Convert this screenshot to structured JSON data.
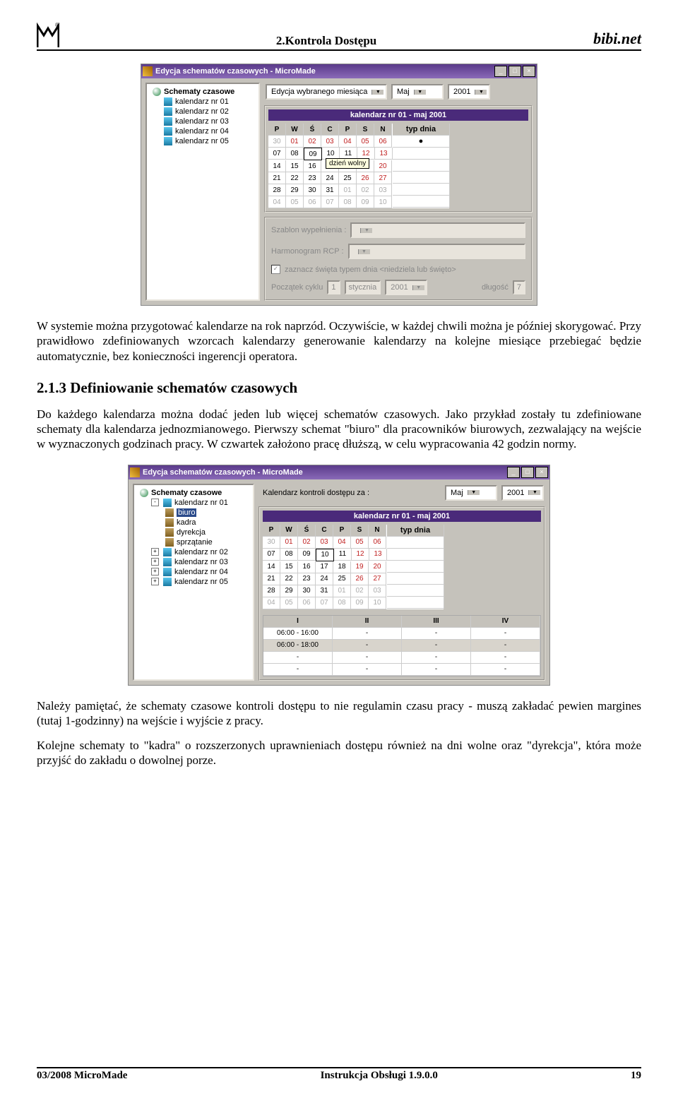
{
  "header": {
    "center": "2.Kontrola Dostępu",
    "brand": "bibi.net"
  },
  "footer": {
    "left": "03/2008 MicroMade",
    "center": "Instrukcja Obsługi  1.9.0.0",
    "right": "19"
  },
  "p1": "W systemie można przygotować kalendarze na rok naprzód. Oczywiście, w każdej chwili można je później skorygować. Przy prawidłowo zdefiniowanych wzorcach kalendarzy generowanie kalendarzy na kolejne miesiące przebiegać będzie automatycznie, bez konieczności ingerencji operatora.",
  "h3": "2.1.3 Definiowanie schematów czasowych",
  "p2": "Do każdego kalendarza można dodać jeden lub więcej schematów czasowych. Jako przykład zostały tu zdefiniowane schematy dla kalendarza jednozmianowego. Pierwszy schemat \"biuro\" dla pracowników biurowych, zezwalający na wejście w wyznaczonych godzinach pracy. W czwartek założono pracę dłuższą, w celu wypracowania 42 godzin normy.",
  "p3": "Należy pamiętać, że schematy czasowe kontroli dostępu to nie regulamin czasu pracy - muszą zakładać pewien margines (tutaj 1-godzinny) na wejście i wyjście z pracy.",
  "p4": "Kolejne schematy to \"kadra\" o rozszerzonych uprawnieniach dostępu również na dni wolne oraz \"dyrekcja\", która może przyjść do zakładu o dowolnej porze.",
  "win": {
    "title": "Edycja schematów czasowych - MicroMade",
    "tree1_root": "Schematy czasowe",
    "tree1_items": [
      "kalendarz nr 01",
      "kalendarz nr 02",
      "kalendarz nr 03",
      "kalendarz nr 04",
      "kalendarz nr 05"
    ],
    "combo1": "Edycja wybranego miesiąca",
    "combo2_label": "Kalendarz kontroli dostępu za :",
    "month": "Maj",
    "year": "2001",
    "cal_title": "kalendarz nr 01 - maj 2001",
    "dow": [
      "P",
      "W",
      "Ś",
      "C",
      "P",
      "S",
      "N"
    ],
    "typ": "typ dnia",
    "tooltip": "dzień wolny",
    "szablon": "Szablon wypełnienia :",
    "harm": "Harmonogram RCP :",
    "chk_label": "zaznacz święta typem dnia  <niedziela lub święto>",
    "pocz": "Początek cyklu",
    "pocz_d": "1",
    "pocz_m": "stycznia",
    "pocz_y": "2001",
    "dlg": "długość",
    "dlg_v": "7",
    "tree2_items": [
      "biuro",
      "kadra",
      "dyrekcja",
      "sprzątanie"
    ],
    "slots_hd": [
      "I",
      "II",
      "III",
      "IV"
    ],
    "slot1": "06:00 - 16:00",
    "slot2": "06:00 - 18:00",
    "dash": "-"
  },
  "cal_rows": [
    [
      {
        "v": "30",
        "c": "gray"
      },
      {
        "v": "01",
        "c": "red"
      },
      {
        "v": "02",
        "c": "red"
      },
      {
        "v": "03",
        "c": "red"
      },
      {
        "v": "04",
        "c": "red"
      },
      {
        "v": "05",
        "c": "red"
      },
      {
        "v": "06",
        "c": "red"
      }
    ],
    [
      {
        "v": "07"
      },
      {
        "v": "08"
      },
      {
        "v": "09"
      },
      {
        "v": "10"
      },
      {
        "v": "11"
      },
      {
        "v": "12",
        "c": "red"
      },
      {
        "v": "13",
        "c": "red"
      }
    ],
    [
      {
        "v": "14"
      },
      {
        "v": "15"
      },
      {
        "v": "16"
      },
      {
        "v": "17"
      },
      {
        "v": "18"
      },
      {
        "v": "19",
        "c": "red"
      },
      {
        "v": "20",
        "c": "red"
      }
    ],
    [
      {
        "v": "21"
      },
      {
        "v": "22"
      },
      {
        "v": "23"
      },
      {
        "v": "24"
      },
      {
        "v": "25"
      },
      {
        "v": "26",
        "c": "red"
      },
      {
        "v": "27",
        "c": "red"
      }
    ],
    [
      {
        "v": "28"
      },
      {
        "v": "29"
      },
      {
        "v": "30"
      },
      {
        "v": "31"
      },
      {
        "v": "01",
        "c": "gray"
      },
      {
        "v": "02",
        "c": "gray"
      },
      {
        "v": "03",
        "c": "gray"
      }
    ],
    [
      {
        "v": "04",
        "c": "gray"
      },
      {
        "v": "05",
        "c": "gray"
      },
      {
        "v": "06",
        "c": "gray"
      },
      {
        "v": "07",
        "c": "gray"
      },
      {
        "v": "08",
        "c": "gray"
      },
      {
        "v": "09",
        "c": "gray"
      },
      {
        "v": "10",
        "c": "gray"
      }
    ]
  ]
}
